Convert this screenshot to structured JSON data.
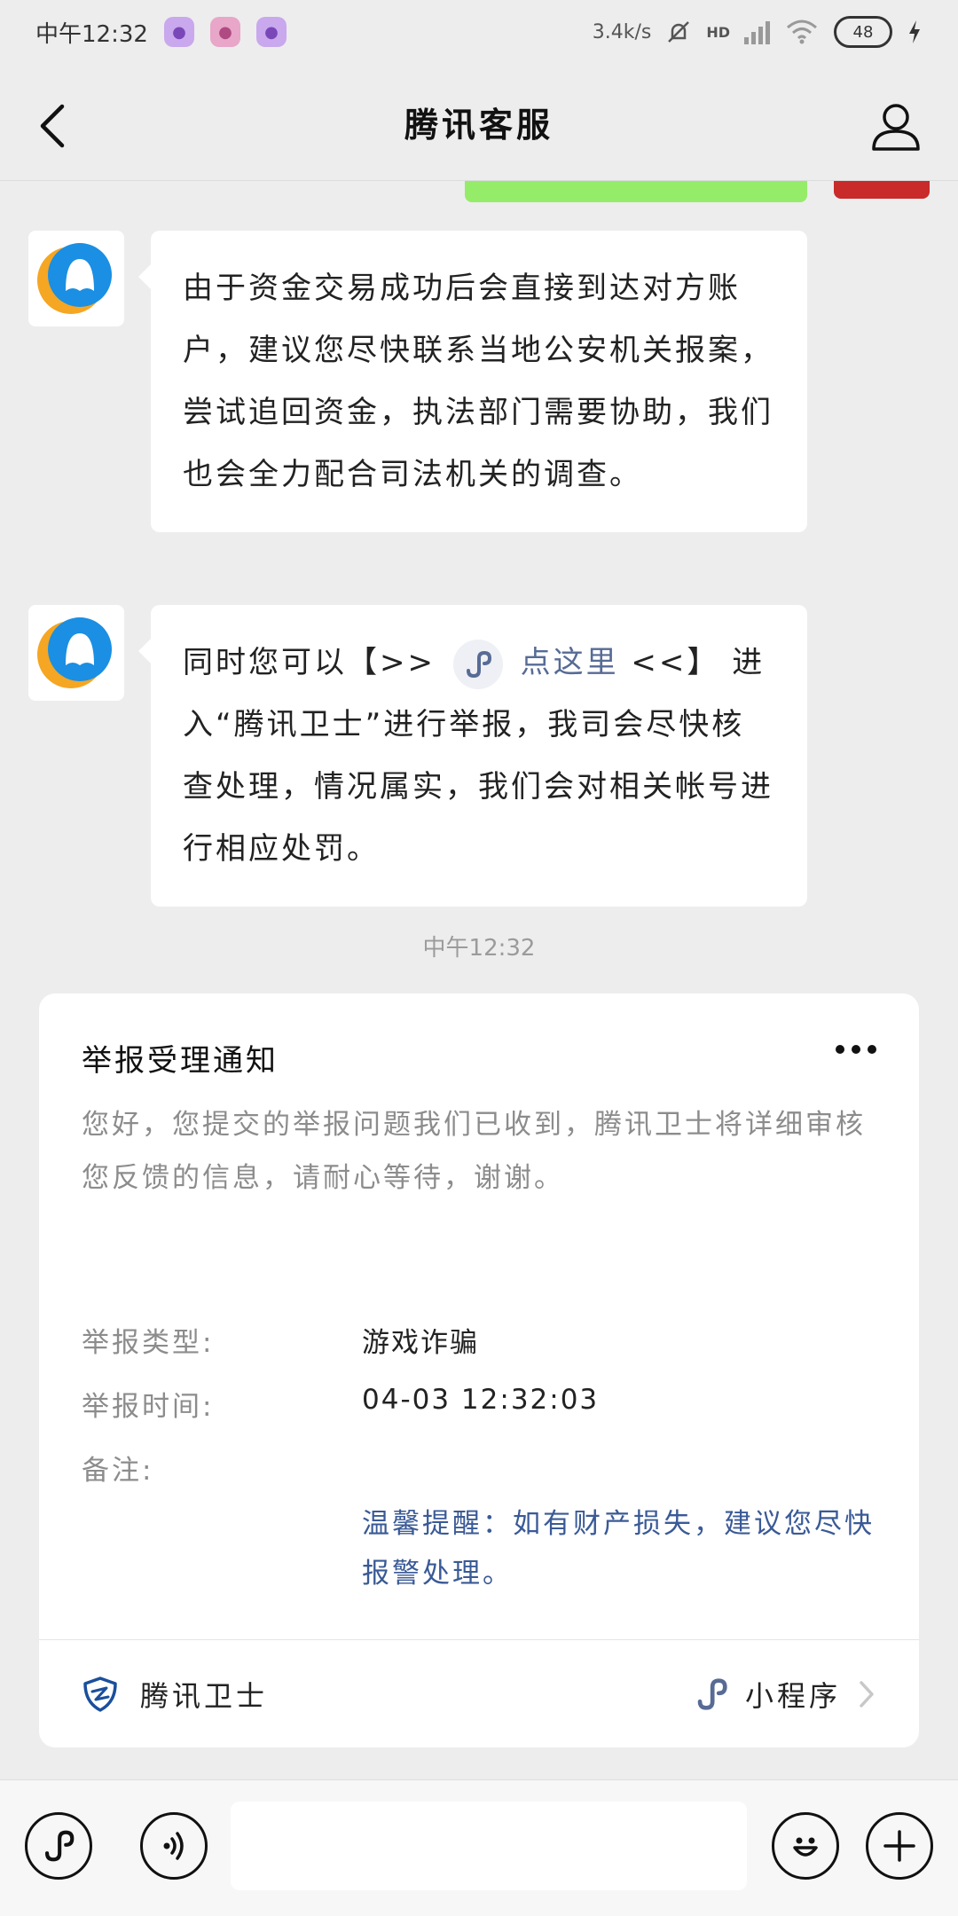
{
  "status_bar": {
    "time": "中午12:32",
    "speed": "3.4k/s",
    "network": "HD",
    "battery": "48"
  },
  "header": {
    "title": "腾讯客服"
  },
  "messages": [
    {
      "text": "由于资金交易成功后会直接到达对方账户，建议您尽快联系当地公安机关报案，尝试追回资金，执法部门需要协助，我们也会全力配合司法机关的调查。"
    },
    {
      "prefix": "同时您可以【>>",
      "link": "点这里",
      "link_suffix": "<<】",
      "text": "进入“腾讯卫士”进行举报，我司会尽快核查处理，情况属实，我们会对相关帐号进行相应处罚。"
    }
  ],
  "timestamp": "中午12:32",
  "notice_card": {
    "title": "举报受理通知",
    "description": "您好，您提交的举报问题我们已收到，腾讯卫士将详细审核您反馈的信息，请耐心等待，谢谢。",
    "fields": [
      {
        "label": "举报类型:",
        "value": "游戏诈骗"
      },
      {
        "label": "举报时间:",
        "value": "04-03 12:32:03"
      },
      {
        "label": "备注:",
        "value": ""
      }
    ],
    "note": "温馨提醒：如有财产损失，建议您尽快报警处理。",
    "footer": {
      "brand": "腾讯卫士",
      "mini_program": "小程序"
    }
  },
  "colors": {
    "link": "#576b95",
    "note": "#3a5a96",
    "outgoing_bubble": "#95ec69",
    "avatar_blue": "#1a8fe3",
    "avatar_yellow": "#f5a623"
  },
  "icons": {
    "back": "chevron-left-icon",
    "profile": "person-icon",
    "mini_program": "link-icon",
    "voice": "voice-icon",
    "emoji": "smile-icon",
    "add": "plus-icon",
    "shield": "shield-icon",
    "more": "more-dots-icon"
  }
}
